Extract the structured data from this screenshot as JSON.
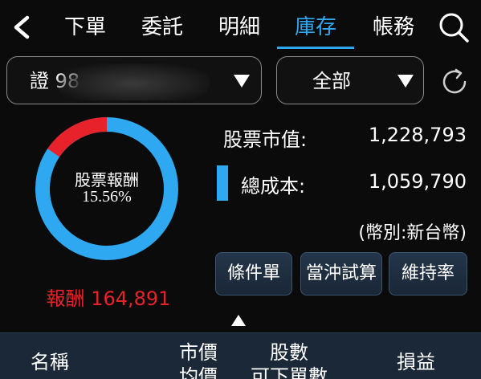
{
  "nav": {
    "tabs": [
      {
        "label": "下單"
      },
      {
        "label": "委託"
      },
      {
        "label": "明細"
      },
      {
        "label": "庫存"
      },
      {
        "label": "帳務"
      }
    ],
    "active_tab": "庫存",
    "back_icon": "chevron-left-icon",
    "search_icon": "search-icon"
  },
  "filters": {
    "account_label": "證 98",
    "account_redacted": true,
    "category_label": "全部"
  },
  "summary": {
    "donut_title": "股票報酬",
    "return_rate": "15.56%",
    "return_fraction": 0.1556,
    "reward_label": "報酬",
    "reward_value": "164,891",
    "market_value_label": "股票市值:",
    "market_value": "1,228,793",
    "total_cost_label": "總成本:",
    "total_cost": "1,059,790",
    "currency_note": "(幣別:新台幣)"
  },
  "actions": {
    "conditional_order": "條件單",
    "day_trade_calc": "當沖試算",
    "margin_ratio": "維持率"
  },
  "table": {
    "headers": {
      "name": "名稱",
      "price_top": "市價",
      "price_bottom": "均價",
      "shares_top": "股數",
      "shares_bottom": "可下單數",
      "pnl": "損益"
    }
  },
  "colors": {
    "accent_blue": "#2ea8f0",
    "reward_red": "#e8222b",
    "background": "#0b0b0b"
  }
}
